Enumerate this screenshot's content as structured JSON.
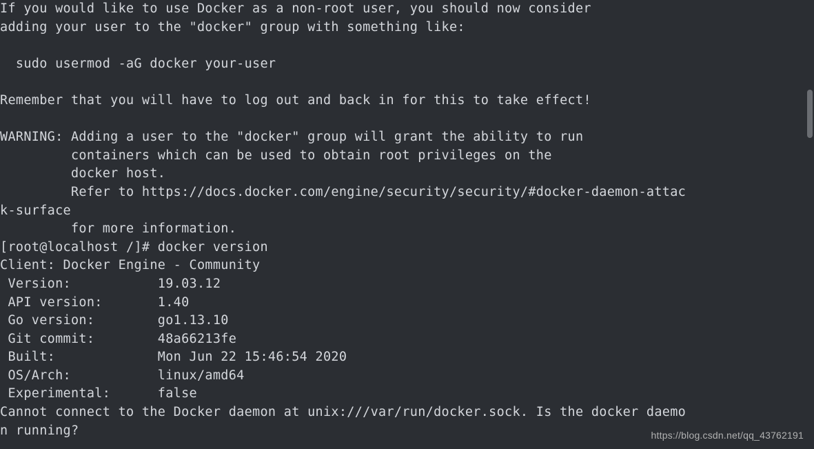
{
  "terminal": {
    "lines": [
      "If you would like to use Docker as a non-root user, you should now consider",
      "adding your user to the \"docker\" group with something like:",
      "",
      "  sudo usermod -aG docker your-user",
      "",
      "Remember that you will have to log out and back in for this to take effect!",
      "",
      "WARNING: Adding a user to the \"docker\" group will grant the ability to run",
      "         containers which can be used to obtain root privileges on the",
      "         docker host.",
      "         Refer to https://docs.docker.com/engine/security/security/#docker-daemon-attac",
      "k-surface",
      "         for more information.",
      "[root@localhost /]# docker version",
      "Client: Docker Engine - Community",
      " Version:           19.03.12",
      " API version:       1.40",
      " Go version:        go1.13.10",
      " Git commit:        48a66213fe",
      " Built:             Mon Jun 22 15:46:54 2020",
      " OS/Arch:           linux/amd64",
      " Experimental:      false",
      "Cannot connect to the Docker daemon at unix:///var/run/docker.sock. Is the docker daemo",
      "n running?"
    ]
  },
  "watermark": {
    "text": "https://blog.csdn.net/qq_43762191"
  }
}
